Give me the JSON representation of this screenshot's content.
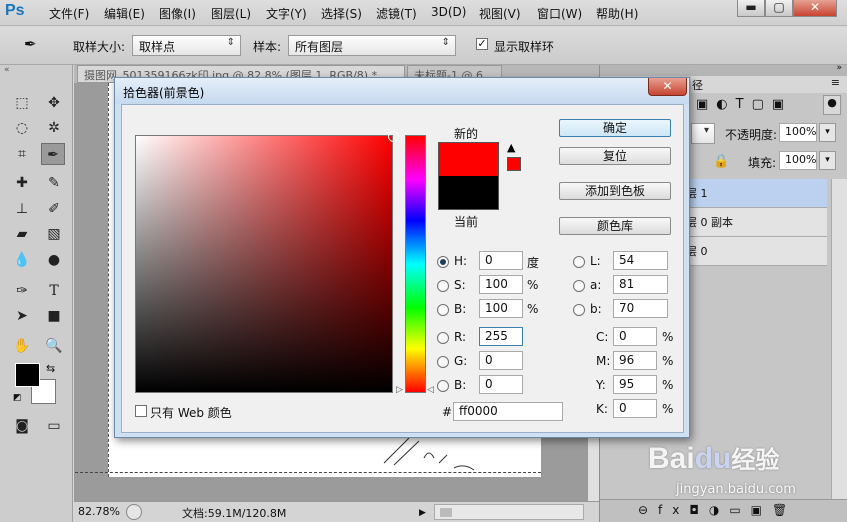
{
  "app": {
    "logo": "Ps"
  },
  "menu": [
    "文件(F)",
    "编辑(E)",
    "图像(I)",
    "图层(L)",
    "文字(Y)",
    "选择(S)",
    "滤镜(T)",
    "3D(D)",
    "视图(V)",
    "窗口(W)",
    "帮助(H)"
  ],
  "window_controls": {
    "minimize": "▬",
    "maximize": "▢",
    "close": "✕"
  },
  "options_bar": {
    "sample_size_label": "取样大小:",
    "sample_size_value": "取样点",
    "sample_label": "样本:",
    "sample_value": "所有图层",
    "show_ring_label": "显示取样环",
    "show_ring_checked": true
  },
  "tabs": [
    {
      "label": "摄图网_501359166zk印.jpg @ 82.8% (图层 1, RGB/8) *",
      "close": "×"
    },
    {
      "label": "未标题-1 @ 6",
      "close": ""
    }
  ],
  "status": {
    "zoom": "82.78%",
    "doc_info": "文档:59.1M/120.8M"
  },
  "right_panel": {
    "opacity_label": "不透明度:",
    "opacity_value": "100%",
    "fill_label": "填充:",
    "fill_value": "100%",
    "lock_label": "锁定:",
    "layers": [
      {
        "name": "层 1",
        "selected": true
      },
      {
        "name": "层 0 副本",
        "selected": false
      },
      {
        "name": "层 0",
        "selected": false
      }
    ],
    "panel_title": "径"
  },
  "dialog": {
    "title": "拾色器(前景色)",
    "close": "✕",
    "new_label": "新的",
    "current_label": "当前",
    "new_color": "#ff0000",
    "current_color": "#000000",
    "buttons": {
      "ok": "确定",
      "reset": "复位",
      "add_to_swatches": "添加到色板",
      "color_libraries": "颜色库"
    },
    "hsb": {
      "H": {
        "label": "H:",
        "value": "0",
        "unit": "度",
        "selected": true
      },
      "S": {
        "label": "S:",
        "value": "100",
        "unit": "%",
        "selected": false
      },
      "B": {
        "label": "B:",
        "value": "100",
        "unit": "%",
        "selected": false
      }
    },
    "rgb": {
      "R": {
        "label": "R:",
        "value": "255"
      },
      "G": {
        "label": "G:",
        "value": "0"
      },
      "B": {
        "label": "B:",
        "value": "0"
      }
    },
    "lab": {
      "L": {
        "label": "L:",
        "value": "54"
      },
      "a": {
        "label": "a:",
        "value": "81"
      },
      "b": {
        "label": "b:",
        "value": "70"
      }
    },
    "cmyk": {
      "C": {
        "label": "C:",
        "value": "0",
        "unit": "%"
      },
      "M": {
        "label": "M:",
        "value": "96",
        "unit": "%"
      },
      "Y": {
        "label": "Y:",
        "value": "95",
        "unit": "%"
      },
      "K": {
        "label": "K:",
        "value": "0",
        "unit": "%"
      }
    },
    "hex": {
      "label": "#",
      "value": "ff0000"
    },
    "web_only": {
      "label": "只有 Web 颜色",
      "checked": false
    },
    "gamut_warning": "!"
  },
  "watermark": {
    "line1": "Bai",
    "paw": "du",
    "suffix": "经验",
    "line2": "jingyan.baidu.com"
  }
}
